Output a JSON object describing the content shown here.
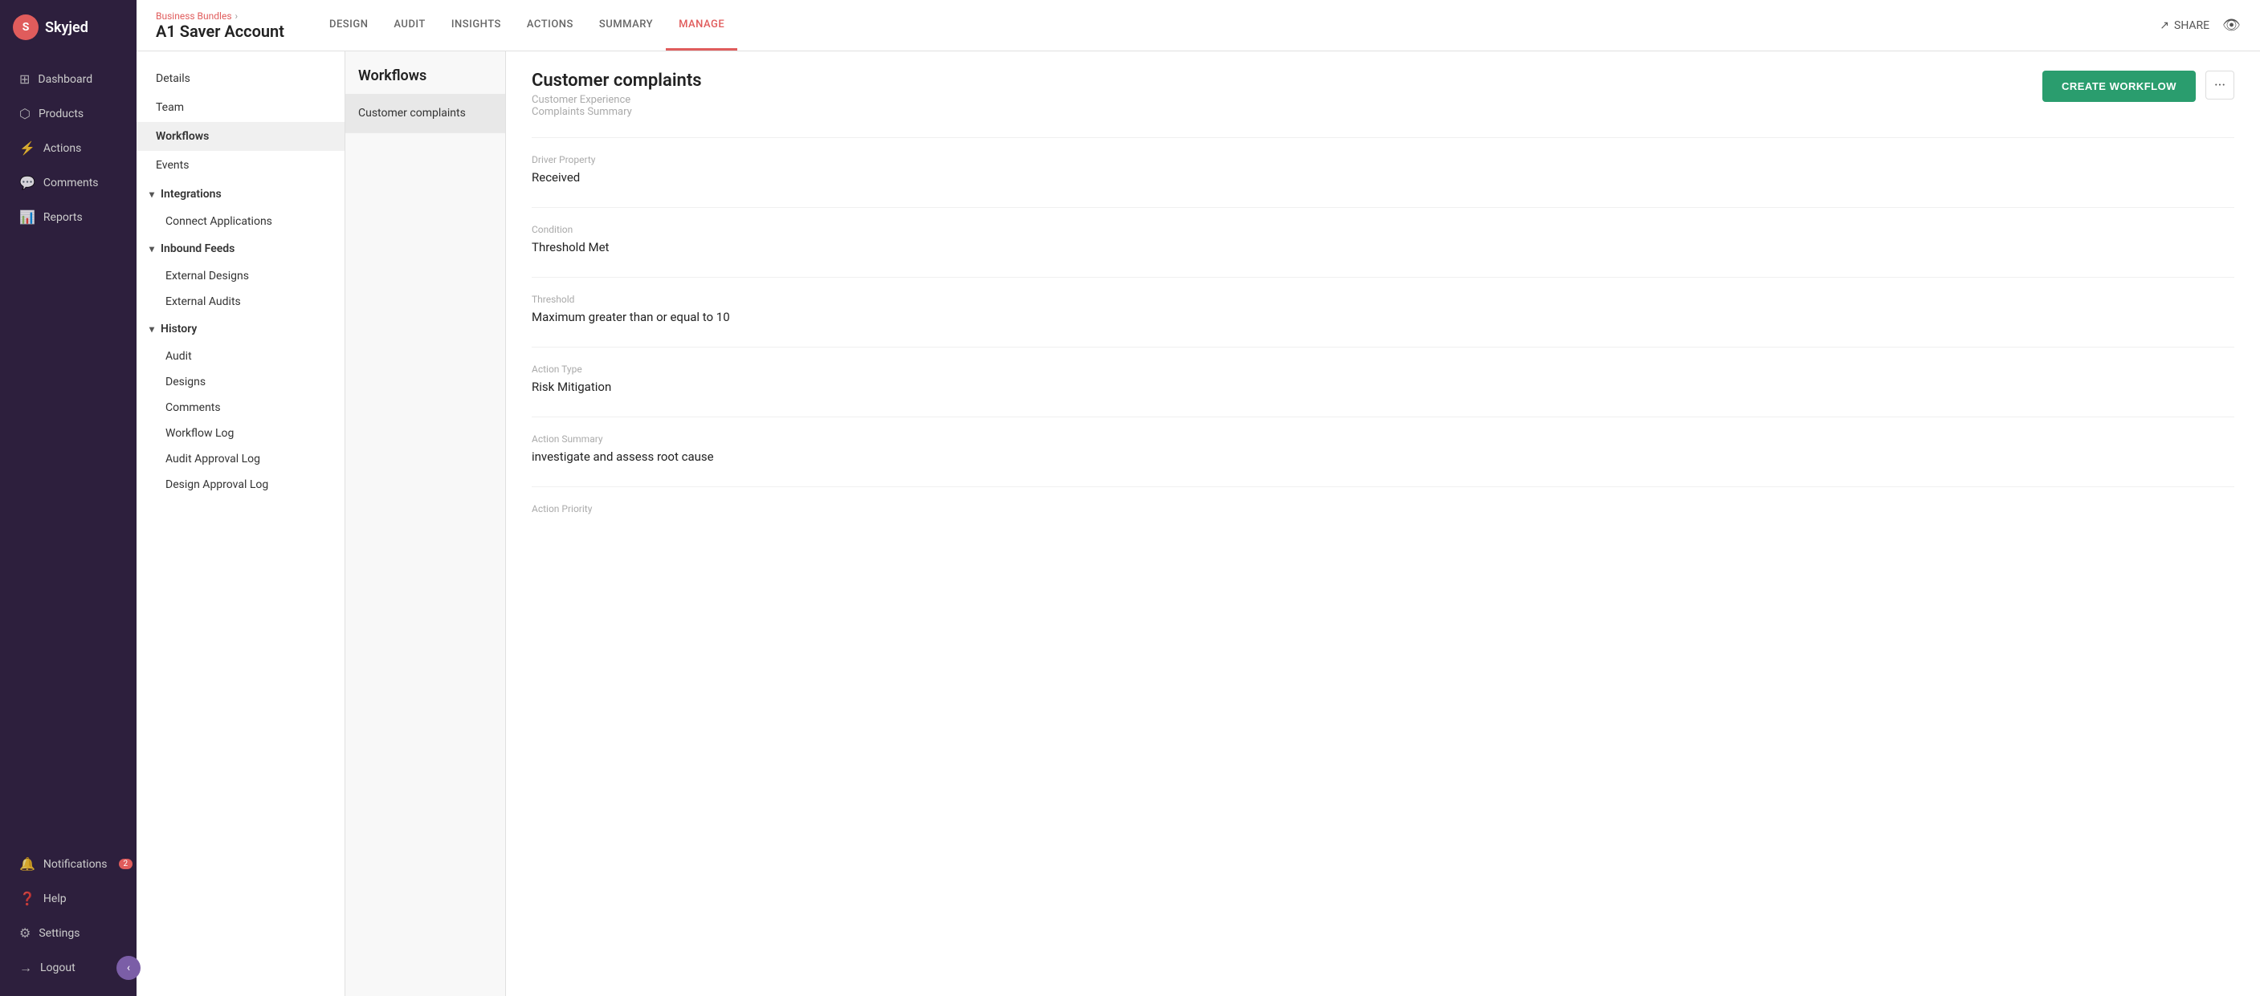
{
  "sidebar": {
    "logo": {
      "initial": "S",
      "name": "Skyjed"
    },
    "nav_items": [
      {
        "id": "dashboard",
        "label": "Dashboard",
        "icon": "⊞"
      },
      {
        "id": "products",
        "label": "Products",
        "icon": "⬡"
      },
      {
        "id": "actions",
        "label": "Actions",
        "icon": "⚡"
      },
      {
        "id": "comments",
        "label": "Comments",
        "icon": "💬"
      },
      {
        "id": "reports",
        "label": "Reports",
        "icon": "📊"
      }
    ],
    "bottom_items": [
      {
        "id": "notifications",
        "label": "Notifications",
        "icon": "🔔",
        "badge": 2
      },
      {
        "id": "help",
        "label": "Help",
        "icon": "?"
      },
      {
        "id": "settings",
        "label": "Settings",
        "icon": "⚙"
      },
      {
        "id": "logout",
        "label": "Logout",
        "icon": "→"
      }
    ],
    "collapse_icon": "‹"
  },
  "header": {
    "breadcrumb": "Business Bundles",
    "page_title": "A1 Saver Account",
    "tabs": [
      {
        "id": "design",
        "label": "DESIGN"
      },
      {
        "id": "audit",
        "label": "AUDIT"
      },
      {
        "id": "insights",
        "label": "INSIGHTS"
      },
      {
        "id": "actions",
        "label": "ACTIONS"
      },
      {
        "id": "summary",
        "label": "SUMMARY"
      },
      {
        "id": "manage",
        "label": "MANAGE",
        "active": true
      }
    ],
    "share_label": "SHARE",
    "eye_icon": "👁"
  },
  "left_panel": {
    "menu_items": [
      {
        "id": "details",
        "label": "Details"
      },
      {
        "id": "team",
        "label": "Team"
      },
      {
        "id": "workflows",
        "label": "Workflows",
        "active": true
      },
      {
        "id": "events",
        "label": "Events"
      }
    ],
    "sections": [
      {
        "id": "integrations",
        "label": "Integrations",
        "expanded": true,
        "sub_items": [
          {
            "id": "connect-applications",
            "label": "Connect Applications"
          }
        ]
      },
      {
        "id": "inbound-feeds",
        "label": "Inbound Feeds",
        "expanded": true,
        "sub_items": [
          {
            "id": "external-designs",
            "label": "External Designs"
          },
          {
            "id": "external-audits",
            "label": "External Audits"
          }
        ]
      },
      {
        "id": "history",
        "label": "History",
        "expanded": true,
        "sub_items": [
          {
            "id": "audit",
            "label": "Audit"
          },
          {
            "id": "designs",
            "label": "Designs"
          },
          {
            "id": "comments",
            "label": "Comments"
          },
          {
            "id": "workflow-log",
            "label": "Workflow Log"
          },
          {
            "id": "audit-approval-log",
            "label": "Audit Approval Log"
          },
          {
            "id": "design-approval-log",
            "label": "Design Approval Log"
          }
        ]
      }
    ]
  },
  "workflow_list": {
    "title": "Workflows",
    "create_btn": "CREATE WORKFLOW",
    "items": [
      {
        "id": "customer-complaints",
        "label": "Customer complaints",
        "active": true
      }
    ]
  },
  "workflow_detail": {
    "name": "Customer complaints",
    "subtitle_line1": "Customer Experience",
    "subtitle_line2": "Complaints Summary",
    "sections": [
      {
        "id": "driver-property",
        "label": "Driver Property",
        "value": "Received"
      },
      {
        "id": "condition",
        "label": "Condition",
        "value": "Threshold Met"
      },
      {
        "id": "threshold",
        "label": "Threshold",
        "value": "Maximum greater than or equal to 10"
      },
      {
        "id": "action-type",
        "label": "Action Type",
        "value": "Risk Mitigation"
      },
      {
        "id": "action-summary",
        "label": "Action Summary",
        "value": "investigate and assess root cause"
      },
      {
        "id": "action-priority",
        "label": "Action Priority",
        "value": ""
      }
    ],
    "three_dots": "···"
  }
}
